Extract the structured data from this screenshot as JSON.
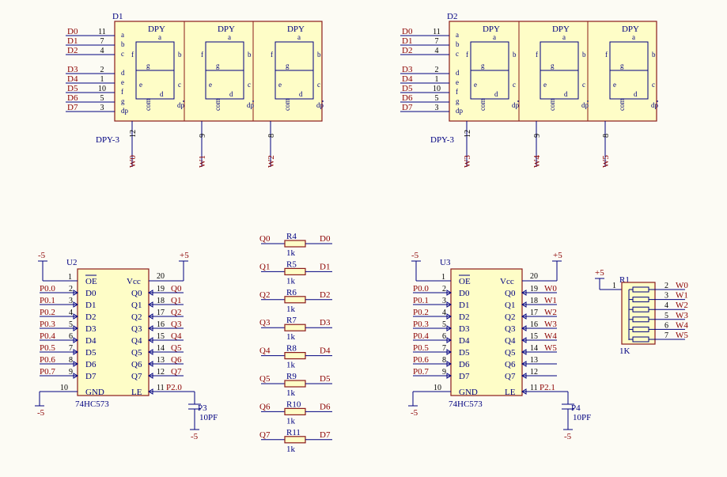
{
  "displays": [
    {
      "designator": "D1",
      "part": "DPY-3",
      "digit_label": "DPY",
      "seg_pins": [
        {
          "net": "D0",
          "num": "11",
          "seg": "a"
        },
        {
          "net": "D1",
          "num": "7",
          "seg": "b"
        },
        {
          "net": "D2",
          "num": "4",
          "seg": "c"
        },
        {
          "net": "D3",
          "num": "2",
          "seg": "d"
        },
        {
          "net": "D4",
          "num": "1",
          "seg": "e"
        },
        {
          "net": "D5",
          "num": "10",
          "seg": "f"
        },
        {
          "net": "D6",
          "num": "5",
          "seg": "g"
        },
        {
          "net": "D7",
          "num": "3",
          "seg": "dp"
        }
      ],
      "com_pins": [
        {
          "num": "12",
          "net": "W0"
        },
        {
          "num": "9",
          "net": "W1"
        },
        {
          "num": "8",
          "net": "W2"
        }
      ]
    },
    {
      "designator": "D2",
      "part": "DPY-3",
      "digit_label": "DPY",
      "seg_pins": [
        {
          "net": "D0",
          "num": "11",
          "seg": "a"
        },
        {
          "net": "D1",
          "num": "7",
          "seg": "b"
        },
        {
          "net": "D2",
          "num": "4",
          "seg": "c"
        },
        {
          "net": "D3",
          "num": "2",
          "seg": "d"
        },
        {
          "net": "D4",
          "num": "1",
          "seg": "e"
        },
        {
          "net": "D5",
          "num": "10",
          "seg": "f"
        },
        {
          "net": "D6",
          "num": "5",
          "seg": "g"
        },
        {
          "net": "D7",
          "num": "3",
          "seg": "dp"
        }
      ],
      "com_pins": [
        {
          "num": "12",
          "net": "W3"
        },
        {
          "num": "9",
          "net": "W4"
        },
        {
          "num": "8",
          "net": "W5"
        }
      ]
    }
  ],
  "segment_letters": {
    "a": "a",
    "b": "b",
    "c": "c",
    "d": "d",
    "e": "e",
    "f": "f",
    "g": "g",
    "dp": "dp",
    "com": "com"
  },
  "latches": [
    {
      "designator": "U2",
      "part": "74HC573",
      "oe_num": "1",
      "oe_label": "OE",
      "vcc_num": "20",
      "vcc_label": "Vcc",
      "gnd_num": "10",
      "gnd_label": "GND",
      "le_num": "11",
      "le_label": "LE",
      "le_net": "P2.0",
      "neg_supply": "-5",
      "pos_supply": "+5",
      "inputs": [
        {
          "net": "P0.0",
          "num": "2",
          "label": "D0"
        },
        {
          "net": "P0.1",
          "num": "3",
          "label": "D1"
        },
        {
          "net": "P0.2",
          "num": "4",
          "label": "D2"
        },
        {
          "net": "P0.3",
          "num": "5",
          "label": "D3"
        },
        {
          "net": "P0.4",
          "num": "6",
          "label": "D4"
        },
        {
          "net": "P0.5",
          "num": "7",
          "label": "D5"
        },
        {
          "net": "P0.6",
          "num": "8",
          "label": "D6"
        },
        {
          "net": "P0.7",
          "num": "9",
          "label": "D7"
        }
      ],
      "outputs": [
        {
          "label": "Q0",
          "num": "19",
          "net": "Q0"
        },
        {
          "label": "Q1",
          "num": "18",
          "net": "Q1"
        },
        {
          "label": "Q2",
          "num": "17",
          "net": "Q2"
        },
        {
          "label": "Q3",
          "num": "16",
          "net": "Q3"
        },
        {
          "label": "Q4",
          "num": "15",
          "net": "Q4"
        },
        {
          "label": "Q5",
          "num": "14",
          "net": "Q5"
        },
        {
          "label": "Q6",
          "num": "13",
          "net": "Q6"
        },
        {
          "label": "Q7",
          "num": "12",
          "net": "Q7"
        }
      ],
      "cap": {
        "designator": "P3",
        "value": "10PF",
        "supply": "-5"
      }
    },
    {
      "designator": "U3",
      "part": "74HC573",
      "oe_num": "1",
      "oe_label": "OE",
      "vcc_num": "20",
      "vcc_label": "Vcc",
      "gnd_num": "10",
      "gnd_label": "GND",
      "le_num": "11",
      "le_label": "LE",
      "le_net": "P2.1",
      "neg_supply": "-5",
      "pos_supply": "+5",
      "inputs": [
        {
          "net": "P0.0",
          "num": "2",
          "label": "D0"
        },
        {
          "net": "P0.1",
          "num": "3",
          "label": "D1"
        },
        {
          "net": "P0.2",
          "num": "4",
          "label": "D2"
        },
        {
          "net": "P0.3",
          "num": "5",
          "label": "D3"
        },
        {
          "net": "P0.4",
          "num": "6",
          "label": "D4"
        },
        {
          "net": "P0.5",
          "num": "7",
          "label": "D5"
        },
        {
          "net": "P0.6",
          "num": "8",
          "label": "D6"
        },
        {
          "net": "P0.7",
          "num": "9",
          "label": "D7"
        }
      ],
      "outputs": [
        {
          "label": "Q0",
          "num": "19",
          "net": "W0"
        },
        {
          "label": "Q1",
          "num": "18",
          "net": "W1"
        },
        {
          "label": "Q2",
          "num": "17",
          "net": "W2"
        },
        {
          "label": "Q3",
          "num": "16",
          "net": "W3"
        },
        {
          "label": "Q4",
          "num": "15",
          "net": "W4"
        },
        {
          "label": "Q5",
          "num": "14",
          "net": "W5"
        },
        {
          "label": "Q6",
          "num": "13",
          "net": ""
        },
        {
          "label": "Q7",
          "num": "12",
          "net": ""
        }
      ],
      "cap": {
        "designator": "P4",
        "value": "10PF",
        "supply": "-5"
      }
    }
  ],
  "resistors": [
    {
      "designator": "R4",
      "value": "1k",
      "left": "Q0",
      "right": "D0"
    },
    {
      "designator": "R5",
      "value": "1k",
      "left": "Q1",
      "right": "D1"
    },
    {
      "designator": "R6",
      "value": "1k",
      "left": "Q2",
      "right": "D2"
    },
    {
      "designator": "R7",
      "value": "1k",
      "left": "Q3",
      "right": "D3"
    },
    {
      "designator": "R8",
      "value": "1k",
      "left": "Q4",
      "right": "D4"
    },
    {
      "designator": "R9",
      "value": "1k",
      "left": "Q5",
      "right": "D5"
    },
    {
      "designator": "R10",
      "value": "1k",
      "left": "Q6",
      "right": "D6"
    },
    {
      "designator": "R11",
      "value": "1k",
      "left": "Q7",
      "right": "D7"
    }
  ],
  "pack": {
    "designator": "R1",
    "value": "1K",
    "supply": "+5",
    "common_num": "1",
    "pins": [
      {
        "num": "2",
        "net": "W0"
      },
      {
        "num": "3",
        "net": "W1"
      },
      {
        "num": "4",
        "net": "W2"
      },
      {
        "num": "5",
        "net": "W3"
      },
      {
        "num": "6",
        "net": "W4"
      },
      {
        "num": "7",
        "net": "W5"
      }
    ]
  },
  "colors": {
    "background": "#fcfbf4",
    "body": "#fefdc7",
    "outline": "#8b1a1a",
    "wire": "#000080",
    "net": "#8b0000"
  }
}
